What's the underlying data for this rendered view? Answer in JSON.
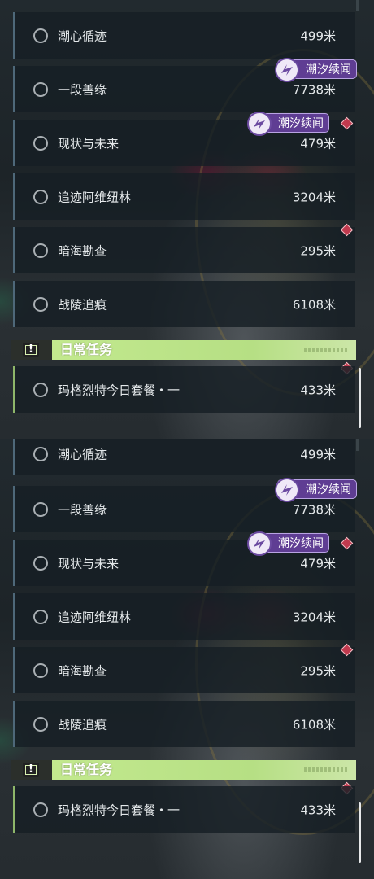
{
  "panels": [
    {
      "quests": [
        {
          "name": "潮心循迹",
          "distance": "499米"
        },
        {
          "name": "一段善缘",
          "distance": "7738米",
          "tag": "潮汐续闻"
        },
        {
          "name": "现状与未来",
          "distance": "479米",
          "tag": "潮汐续闻"
        },
        {
          "name": "追迹阿维纽林",
          "distance": "3204米"
        },
        {
          "name": "暗海勘查",
          "distance": "295米"
        },
        {
          "name": "战陵追痕",
          "distance": "6108米"
        }
      ],
      "daily_header": {
        "title": "日常任务",
        "icon": "alert-icon"
      },
      "daily_quests": [
        {
          "name": "玛格烈特今日套餐・一",
          "distance": "433米"
        }
      ]
    },
    {
      "quests": [
        {
          "name": "潮心循迹",
          "distance": "499米"
        },
        {
          "name": "一段善缘",
          "distance": "7738米",
          "tag": "潮汐续闻"
        },
        {
          "name": "现状与未来",
          "distance": "479米",
          "tag": "潮汐续闻"
        },
        {
          "name": "追迹阿维纽林",
          "distance": "3204米"
        },
        {
          "name": "暗海勘查",
          "distance": "295米"
        },
        {
          "name": "战陵追痕",
          "distance": "6108米"
        }
      ],
      "daily_header": {
        "title": "日常任务",
        "icon": "alert-icon"
      },
      "daily_quests": [
        {
          "name": "玛格烈特今日套餐・一",
          "distance": "433米"
        }
      ]
    }
  ],
  "colors": {
    "tag_bg": "#5f3d93",
    "daily_accent": "#c5eb90",
    "marker": "#c13a4e",
    "row_border": "#4e6879"
  }
}
